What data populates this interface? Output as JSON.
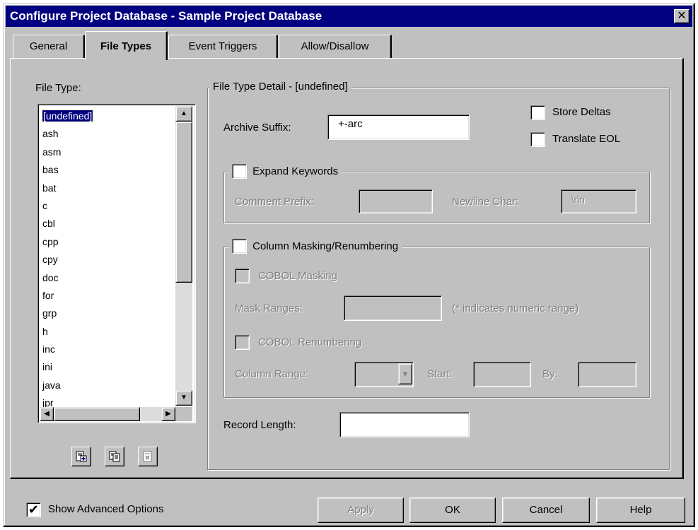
{
  "window": {
    "title": "Configure Project Database - Sample Project Database"
  },
  "tabs": [
    {
      "label": "General",
      "active": false
    },
    {
      "label": "File Types",
      "active": true
    },
    {
      "label": "Event Triggers",
      "active": false
    },
    {
      "label": "Allow/Disallow",
      "active": false
    }
  ],
  "file_type_panel": {
    "label": "File Type:",
    "items": [
      "[undefined]",
      "ash",
      "asm",
      "bas",
      "bat",
      "c",
      "cbl",
      "cpp",
      "cpy",
      "doc",
      "for",
      "grp",
      "h",
      "inc",
      "ini",
      "java",
      "jpr"
    ],
    "selected": "[undefined]"
  },
  "detail": {
    "group_title": "File Type Detail - [undefined]",
    "archive_suffix_label": "Archive Suffix:",
    "archive_suffix_value": "+-arc",
    "store_deltas_label": "Store Deltas",
    "translate_eol_label": "Translate EOL",
    "expand_keywords_label": "Expand Keywords",
    "comment_prefix_label": "Comment Prefix:",
    "comment_prefix_value": "",
    "newline_char_label": "Newline Char:",
    "newline_char_value": "\\r\\n",
    "column_masking_label": "Column Masking/Renumbering",
    "cobol_masking_label": "COBOL Masking",
    "mask_ranges_label": "Mask Ranges:",
    "mask_ranges_value": "",
    "mask_ranges_hint": "(* indicates numeric range)",
    "cobol_renumbering_label": "COBOL Renumbering",
    "column_range_label": "Column Range:",
    "start_label": "Start:",
    "by_label": "By:",
    "record_length_label": "Record Length:",
    "record_length_value": ""
  },
  "footer": {
    "show_advanced_label": "Show Advanced Options",
    "show_advanced_checked": true,
    "apply_label": "Apply",
    "ok_label": "OK",
    "cancel_label": "Cancel",
    "help_label": "Help"
  },
  "colors": {
    "titlebar": "#000080",
    "face": "#c0c0c0",
    "selection": "#000080"
  }
}
